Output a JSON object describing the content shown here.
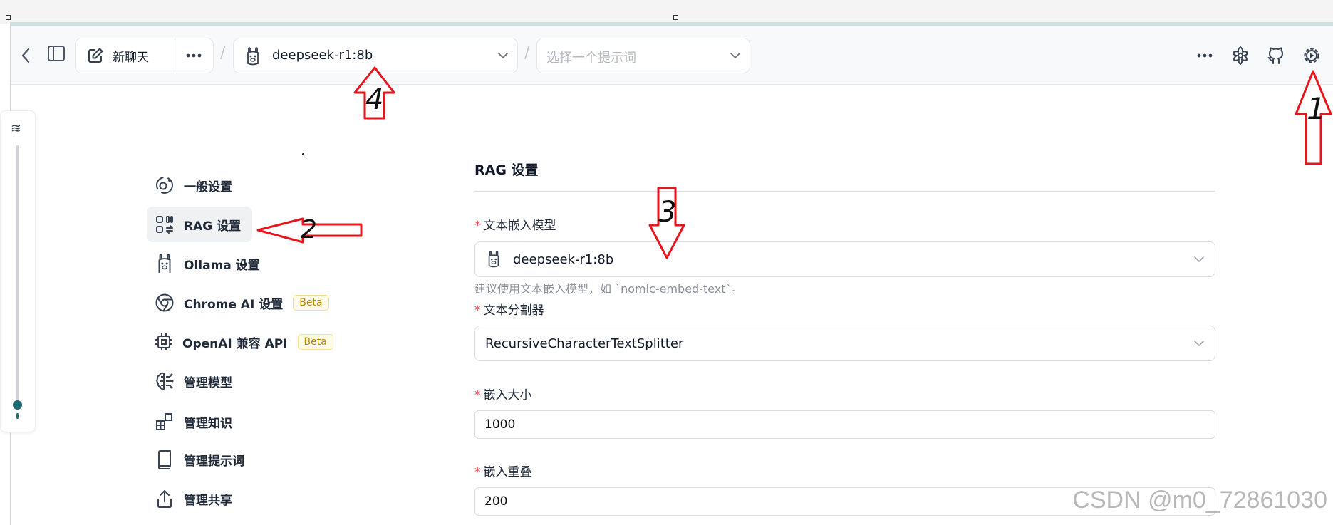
{
  "header": {
    "back_label": "‹",
    "new_chat_label": "新聊天",
    "model_selected": "deepseek-r1:8b",
    "prompt_placeholder": "选择一个提示词",
    "separator": "/"
  },
  "nav": {
    "items": [
      {
        "label": "一般设置",
        "icon": "general-settings-icon"
      },
      {
        "label": "RAG 设置",
        "icon": "rag-icon",
        "active": true
      },
      {
        "label": "Ollama 设置",
        "icon": "llama-icon"
      },
      {
        "label": "Chrome AI 设置",
        "icon": "chrome-icon",
        "badge": "Beta"
      },
      {
        "label": "OpenAI 兼容 API",
        "icon": "chip-icon",
        "badge": "Beta"
      },
      {
        "label": "管理模型",
        "icon": "brain-icon"
      },
      {
        "label": "管理知识",
        "icon": "blocks-icon"
      },
      {
        "label": "管理提示词",
        "icon": "book-icon"
      },
      {
        "label": "管理共享",
        "icon": "share-icon"
      }
    ]
  },
  "rag": {
    "title": "RAG 设置",
    "embedding_model": {
      "label": "文本嵌入模型",
      "value": "deepseek-r1:8b",
      "hint": "建议使用文本嵌入模型，如 `nomic-embed-text`。"
    },
    "splitter": {
      "label": "文本分割器",
      "value": "RecursiveCharacterTextSplitter"
    },
    "chunk_size": {
      "label": "嵌入大小",
      "value": "1000"
    },
    "chunk_overlap": {
      "label": "嵌入重叠",
      "value": "200"
    },
    "required_mark": "*"
  },
  "annotations": {
    "arrow_1": "1",
    "arrow_2": "2",
    "arrow_3": "3",
    "arrow_4": "4",
    "color": "#e8141c"
  },
  "slider": {
    "level": 0.0
  },
  "watermark": "CSDN @m0_72861030"
}
